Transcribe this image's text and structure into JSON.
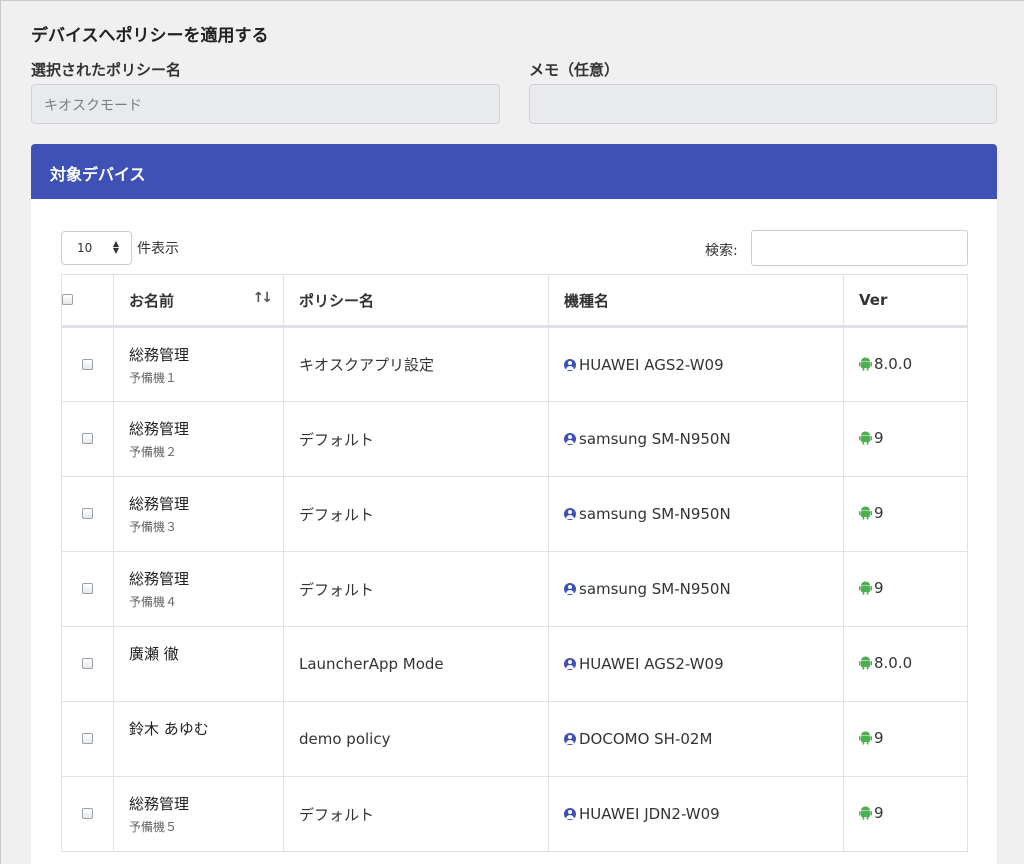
{
  "page": {
    "heading": "デバイスへポリシーを適用する"
  },
  "policy_field": {
    "label": "選択されたポリシー名",
    "value": "キオスクモード"
  },
  "memo_field": {
    "label": "メモ（任意）",
    "value": ""
  },
  "card": {
    "title": "対象デバイス"
  },
  "table_controls": {
    "page_length": "10",
    "page_length_label": "件表示",
    "search_label": "検索:",
    "search_value": ""
  },
  "table": {
    "headers": {
      "name": "お名前",
      "policy": "ポリシー名",
      "model": "機種名",
      "version": "Ver"
    },
    "sort_icon": "sort-icon",
    "rows": [
      {
        "name": "総務管理",
        "sub": "予備機１",
        "policy": "キオスクアプリ設定",
        "model": "HUAWEI AGS2-W09",
        "version": "8.0.0"
      },
      {
        "name": "総務管理",
        "sub": "予備機２",
        "policy": "デフォルト",
        "model": "samsung SM-N950N",
        "version": "9"
      },
      {
        "name": "総務管理",
        "sub": "予備機３",
        "policy": "デフォルト",
        "model": "samsung SM-N950N",
        "version": "9"
      },
      {
        "name": "総務管理",
        "sub": "予備機４",
        "policy": "デフォルト",
        "model": "samsung SM-N950N",
        "version": "9"
      },
      {
        "name": "廣瀬 徹",
        "sub": "",
        "policy": "LauncherApp Mode",
        "model": "HUAWEI AGS2-W09",
        "version": "8.0.0"
      },
      {
        "name": "鈴木 あゆむ",
        "sub": "",
        "policy": "demo policy",
        "model": "DOCOMO SH-02M",
        "version": "9"
      },
      {
        "name": "総務管理",
        "sub": "予備機５",
        "policy": "デフォルト",
        "model": "HUAWEI JDN2-W09",
        "version": "9"
      }
    ]
  },
  "colors": {
    "accent": "#3f51b5",
    "android": "#4caf50"
  },
  "icons": {
    "model": "user-circle-icon",
    "version": "android-icon"
  }
}
